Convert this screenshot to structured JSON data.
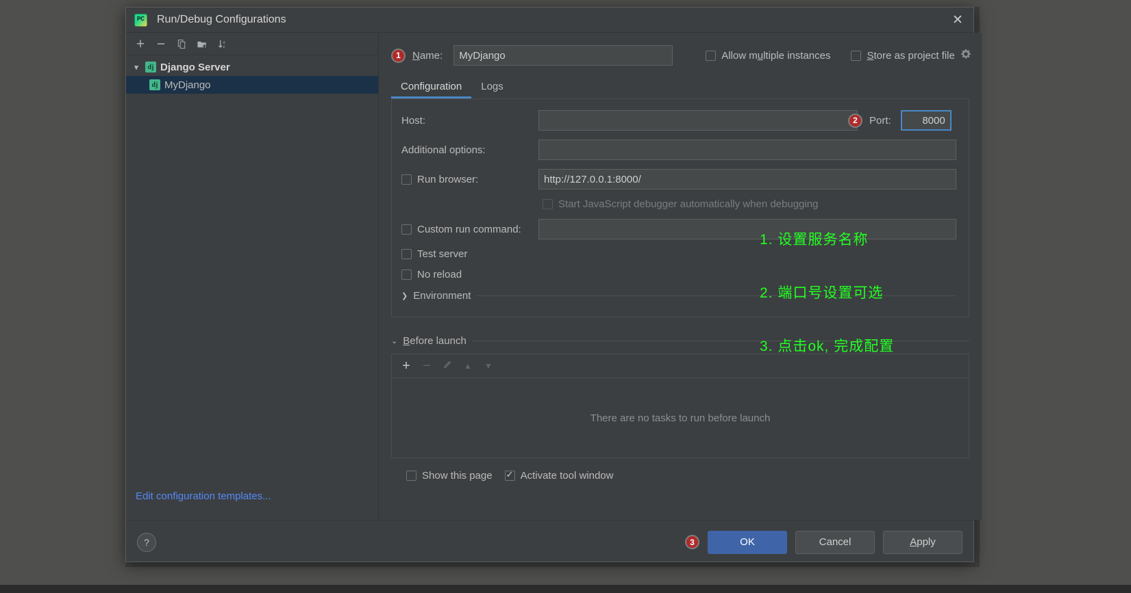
{
  "window": {
    "title": "Run/Debug Configurations",
    "logo_icon": "pycharm-logo-icon",
    "close_icon": "close-icon"
  },
  "left_pane": {
    "toolbar": [
      {
        "name": "add-configuration-button",
        "glyph": "+"
      },
      {
        "name": "remove-configuration-button",
        "glyph": "−"
      },
      {
        "name": "copy-configuration-button",
        "glyph": "⧉"
      },
      {
        "name": "save-configuration-button",
        "glyph": "❐"
      },
      {
        "name": "sort-configurations-button",
        "glyph": "↓"
      }
    ],
    "tree": [
      {
        "label": "Django Server",
        "type": "group",
        "expand_icon": "chevron-down-icon",
        "badge": "dj"
      },
      {
        "label": "MyDjango",
        "type": "child",
        "selected": true,
        "badge": "dj"
      }
    ],
    "edit_templates_link": "Edit configuration templates..."
  },
  "header": {
    "marker_1": "1",
    "name_label": "Name:",
    "name_value": "MyDjango",
    "allow_multiple_instances_label": "Allow multiple instances",
    "allow_multiple_instances_checked": false,
    "store_as_project_file_label": "Store as project file",
    "store_as_project_file_checked": false,
    "gear_icon": "gear-icon"
  },
  "tabs": [
    {
      "label": "Configuration",
      "active": true
    },
    {
      "label": "Logs",
      "active": false
    }
  ],
  "configuration": {
    "host_label": "Host:",
    "host_value": "",
    "marker_2": "2",
    "port_label": "Port:",
    "port_value": "8000",
    "additional_options_label": "Additional options:",
    "additional_options_value": "",
    "run_browser_label": "Run browser:",
    "run_browser_checked": false,
    "run_browser_url": "http://127.0.0.1:8000/",
    "start_js_debugger_label": "Start JavaScript debugger automatically when debugging",
    "start_js_debugger_checked": false,
    "start_js_debugger_disabled": true,
    "custom_run_command_label": "Custom run command:",
    "custom_run_command_checked": false,
    "custom_run_command_value": "",
    "test_server_label": "Test server",
    "test_server_checked": false,
    "no_reload_label": "No reload",
    "no_reload_checked": false,
    "environment_label": "Environment",
    "environment_expand_icon": "chevron-right-icon"
  },
  "before_launch": {
    "title": "Before launch",
    "expand_icon": "chevron-down-icon",
    "toolbar": [
      {
        "name": "add-task-button",
        "glyph": "+",
        "enabled": true
      },
      {
        "name": "remove-task-button",
        "glyph": "−",
        "enabled": false
      },
      {
        "name": "edit-task-button",
        "glyph": "✎",
        "enabled": false
      },
      {
        "name": "move-task-up-button",
        "glyph": "▲",
        "enabled": false
      },
      {
        "name": "move-task-down-button",
        "glyph": "▼",
        "enabled": false
      }
    ],
    "empty_text": "There are no tasks to run before launch",
    "show_this_page_label": "Show this page",
    "show_this_page_checked": false,
    "activate_tool_window_label": "Activate tool window",
    "activate_tool_window_checked": true
  },
  "annotation": {
    "color": "#22ff22",
    "lines": [
      "1. 设置服务名称",
      "2. 端口号设置可选",
      "3. 点击ok, 完成配置"
    ]
  },
  "footer": {
    "help_icon": "help-icon",
    "marker_3": "3",
    "ok_label": "OK",
    "cancel_label": "Cancel",
    "apply_label": "Apply"
  }
}
